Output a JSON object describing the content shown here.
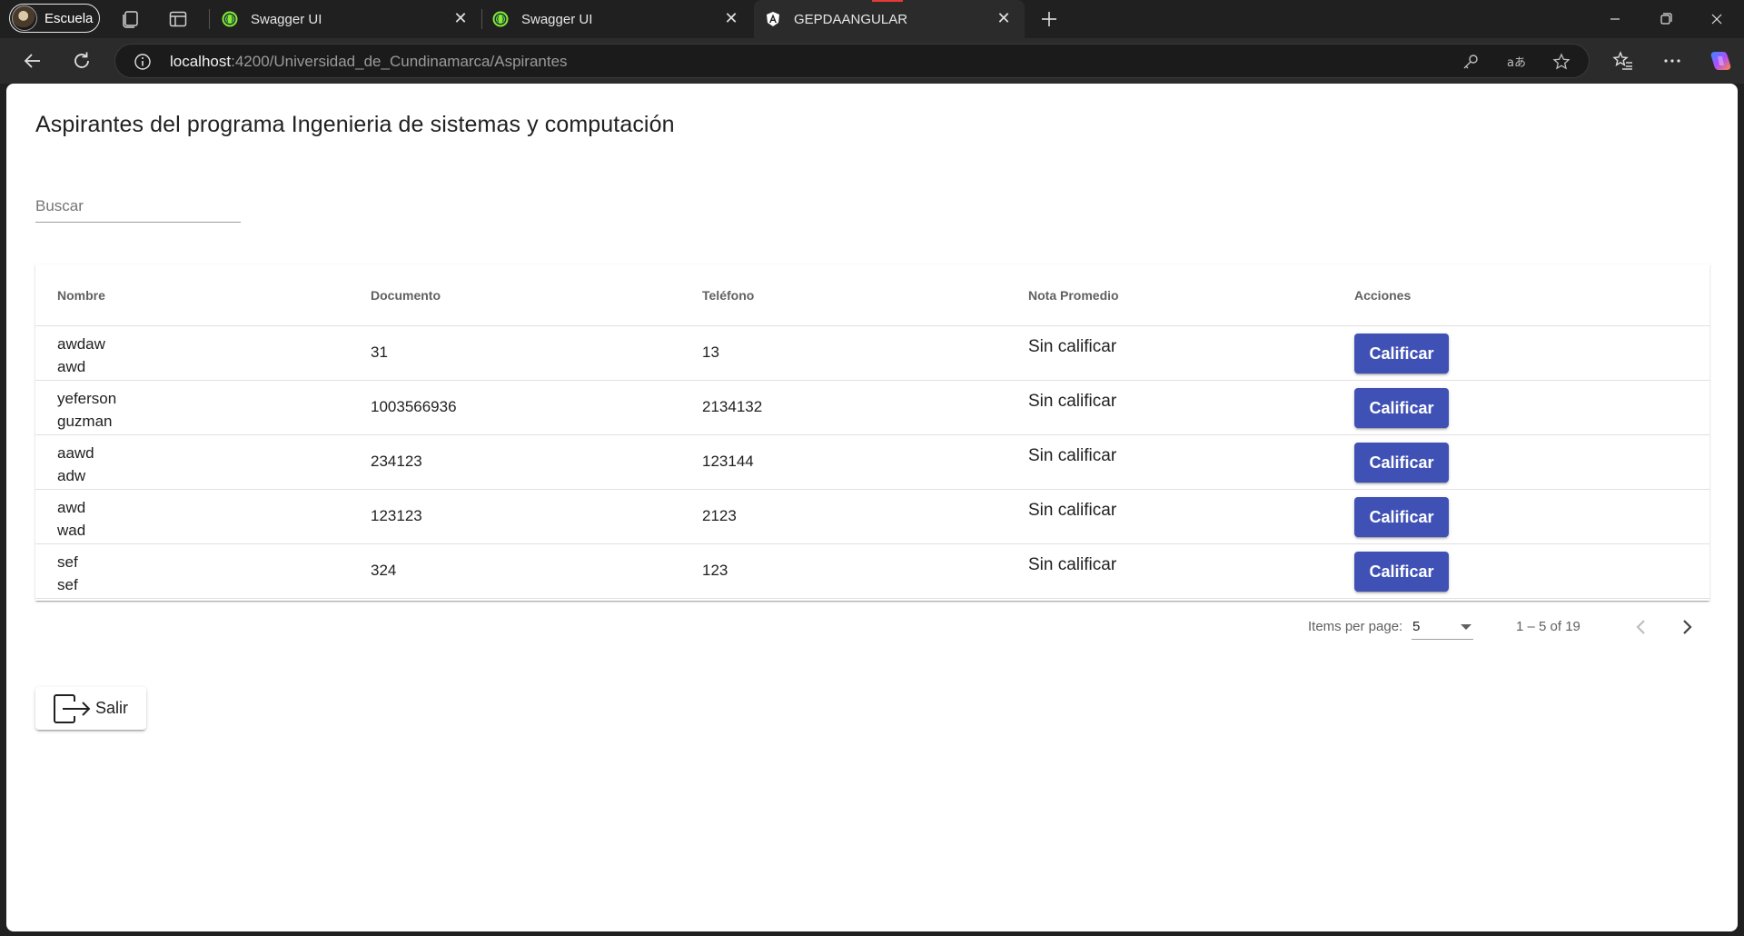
{
  "browser": {
    "profile_label": "Escuela",
    "tabs": [
      {
        "title": "Swagger UI",
        "icon": "swagger-icon"
      },
      {
        "title": "Swagger UI",
        "icon": "swagger-icon"
      },
      {
        "title": "GEPDAANGULAR",
        "icon": "angular-icon",
        "active": true
      }
    ],
    "url_host": "localhost",
    "url_rest": ":4200/Universidad_de_Cundinamarca/Aspirantes"
  },
  "page": {
    "title": "Aspirantes del programa Ingenieria de sistemas y computación",
    "search_placeholder": "Buscar"
  },
  "table": {
    "headers": {
      "nombre": "Nombre",
      "documento": "Documento",
      "telefono": "Teléfono",
      "nota": "Nota Promedio",
      "acciones": "Acciones"
    },
    "rows": [
      {
        "nombre1": "awdaw",
        "nombre2": "awd",
        "documento": "31",
        "telefono": "13",
        "nota": "Sin calificar",
        "accion": "Calificar"
      },
      {
        "nombre1": "yeferson",
        "nombre2": "guzman",
        "documento": "1003566936",
        "telefono": "2134132",
        "nota": "Sin calificar",
        "accion": "Calificar"
      },
      {
        "nombre1": "aawd",
        "nombre2": "adw",
        "documento": "234123",
        "telefono": "123144",
        "nota": "Sin calificar",
        "accion": "Calificar"
      },
      {
        "nombre1": "awd",
        "nombre2": "wad",
        "documento": "123123",
        "telefono": "2123",
        "nota": "Sin calificar",
        "accion": "Calificar"
      },
      {
        "nombre1": "sef",
        "nombre2": "sef",
        "documento": "324",
        "telefono": "123",
        "nota": "Sin calificar",
        "accion": "Calificar"
      }
    ]
  },
  "paginator": {
    "items_per_page_label": "Items per page:",
    "page_size": "5",
    "range_label": "1 – 5 of 19"
  },
  "actions": {
    "salir_label": "Salir"
  },
  "colors": {
    "primary": "#3f51b5",
    "swagger_green": "#85ea2d"
  }
}
